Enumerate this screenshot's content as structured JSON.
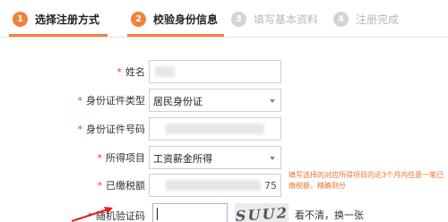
{
  "steps": [
    {
      "num": "1",
      "label": "选择注册方式",
      "state": "active"
    },
    {
      "num": "2",
      "label": "校验身份信息",
      "state": "active"
    },
    {
      "num": "3",
      "label": "填写基本资料",
      "state": "inactive"
    },
    {
      "num": "4",
      "label": "注册完成",
      "state": "inactive"
    }
  ],
  "form": {
    "name_label": "姓名",
    "id_type_label": "身份证件类型",
    "id_type_value": "居民身份证",
    "id_number_label": "身份证件号码",
    "income_label": "所得项目",
    "income_value": "工资薪金所得",
    "tax_paid_label": "已缴税额",
    "tax_paid_suffix": "75",
    "captcha_label": "随机验证码",
    "captcha_text": "SUU2",
    "captcha_refresh": "看不清，换一张"
  },
  "hint": "填写选择的对应所得项目的近3个月内任意一笔已缴税额，精确到分",
  "colors": {
    "accent": "#f08239",
    "required": "#e4393c",
    "hint": "#e8742a"
  }
}
